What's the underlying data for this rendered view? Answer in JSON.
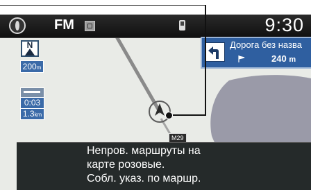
{
  "status_bar": {
    "source": "FM",
    "time": "9:30"
  },
  "icons": {
    "compass": "compass-icon",
    "rds": "rds-icon",
    "phone": "phone-icon",
    "north": "north-up-icon",
    "turn": "turn-left-arrow-icon",
    "flag": "destination-flag-icon"
  },
  "map": {
    "north_label": "N",
    "scale_value": "200",
    "scale_unit": "m",
    "road_label": "M29"
  },
  "route_info": {
    "time": "0:03",
    "distance_value": "1.3",
    "distance_unit": "km"
  },
  "next_turn": {
    "street": "Дорога без назва",
    "distance_value": "240",
    "distance_unit": "m"
  },
  "message": {
    "line1": "Непров. маршруты на",
    "line2": "карте розовые.",
    "line3": "Собл. указ. по маршр."
  },
  "colors": {
    "accent": "#2f5fa0",
    "route_line": "#8a8a8a",
    "map_background": "#e9ebe7",
    "message_background": "#252a2a"
  }
}
